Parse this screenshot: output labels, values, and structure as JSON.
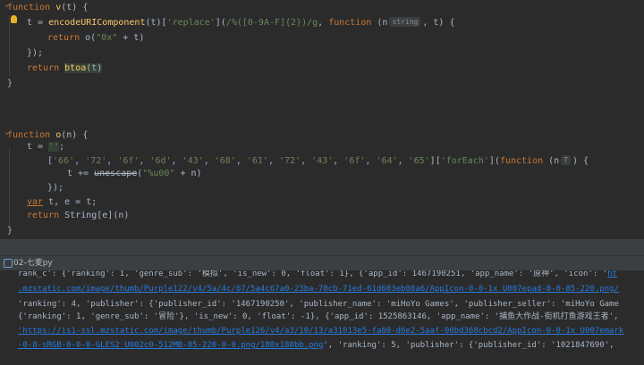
{
  "editor": {
    "l1": {
      "kw": "function",
      "name": "v",
      "rest": "(t) {"
    },
    "l2": {
      "a": "t = ",
      "fn": "encodeURIComponent",
      "b": "(t)[",
      "s1": "'replace'",
      "c": "](",
      "re": "/%([0-9A-F]{2})/g",
      "d": ", ",
      "kw": "function",
      "e": " (n",
      "hint": "string",
      "f": ", t) {"
    },
    "l3": {
      "kw": "return",
      "a": " o(",
      "s": "\"0x\"",
      "b": " + t)"
    },
    "l4": {
      "a": "});"
    },
    "l5": {
      "kw": "return",
      "fn": "btoa",
      "a": "(t)"
    },
    "l6": {
      "a": "}"
    },
    "l7": {
      "kw": "function",
      "name": "o",
      "rest": "(n) {"
    },
    "l8": {
      "a": "t = ",
      "s": "''",
      "b": ";"
    },
    "l9": {
      "open": "[",
      "items": [
        "'66'",
        "'72'",
        "'6f'",
        "'6d'",
        "'43'",
        "'68'",
        "'61'",
        "'72'",
        "'43'",
        "'6f'",
        "'64'",
        "'65'"
      ],
      "close": "][",
      "method": "'forEach'",
      "c": "](",
      "kw": "function",
      "d": " (n",
      "hint": "T",
      "e": ") {"
    },
    "l10": {
      "a": "t += ",
      "dep": "unescape",
      "b": "(",
      "s": "\"%u00\"",
      "c": " + n)"
    },
    "l11": {
      "a": "});"
    },
    "l12": {
      "kw": "var",
      "a": " t, e = t;"
    },
    "l13": {
      "kw": "return",
      "a": " String[e](n)"
    },
    "l14": {
      "a": "}"
    }
  },
  "run": {
    "tab_label": "02-七麦py"
  },
  "console": {
    "lines": [
      {
        "text": "rank_c': {'ranking': 1, 'genre_sub': '模拟', 'is_new': 0, 'float': 1}, {'app_id': 1467190251, 'app_name': '原神', 'icon': '",
        "link": "ht"
      },
      {
        "link": ".mzstatic.com/image/thumb/Purple122/v4/5a/4c/67/5a4c67a0-23ba-70cb-71ed-61d603eb08a6/AppIcon-0-0-1x_U007epad-0-0-85-220.png/"
      },
      {
        "text": "'ranking': 4, 'publisher': {'publisher_id': '1467190250', 'publisher_name': 'miHoYo Games', 'publisher_seller': 'miHoYo Game"
      },
      {
        "text": "{'ranking': 1, 'genre_sub': '冒险'}, 'is_new': 0, 'float': -1}, {'app_id': 1525863146, 'app_name': '捕鱼大作战-街机打鱼游戏王者',"
      },
      {
        "link": "'https://is1-ssl.mzstatic.com/image/thumb/Purple126/v4/a3/10/13/a31013e5-fa60-d6e2-5aaf-00bd368cbcd2/AppIcon-0-0-1x_U007emark"
      },
      {
        "link": "-0-8-sRGB-0-0-0-GLES2_U002c0-512MB-85-220-0-0.png/180x180bb.png",
        "text": "', 'ranking': 5, 'publisher': {'publisher_id': '1021847690',"
      }
    ]
  }
}
